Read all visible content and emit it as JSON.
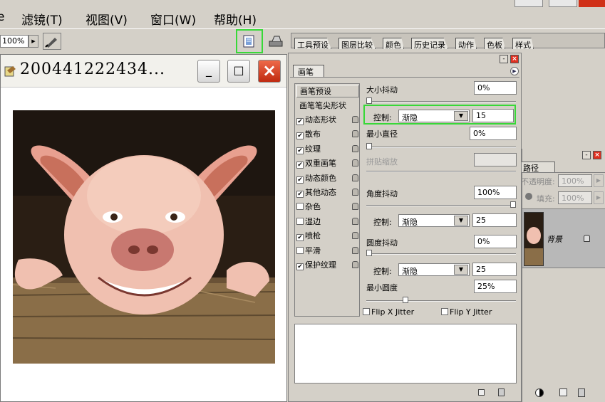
{
  "menu": [
    "滤镜(T)",
    "视图(V)",
    "窗口(W)",
    "帮助(H)"
  ],
  "toolbar": {
    "zoom": "100%"
  },
  "palette_well": {
    "tabs": [
      "工具预设",
      "图层比较",
      "颜色",
      "历史记录",
      "动作",
      "色板",
      "样式"
    ]
  },
  "document": {
    "title": "200441222434...",
    "minimize": "_",
    "maximize": "□",
    "close": "×"
  },
  "brush_panel": {
    "tab": "画笔",
    "preset_button": "画笔预设",
    "tip_header": "画笔笔尖形状",
    "options": [
      {
        "label": "动态形状",
        "checked": true
      },
      {
        "label": "散布",
        "checked": true
      },
      {
        "label": "纹理",
        "checked": true
      },
      {
        "label": "双重画笔",
        "checked": true
      },
      {
        "label": "动态颜色",
        "checked": true
      },
      {
        "label": "其他动态",
        "checked": true
      },
      {
        "label": "杂色",
        "checked": false
      },
      {
        "label": "湿边",
        "checked": false
      },
      {
        "label": "喷枪",
        "checked": true
      },
      {
        "label": "平滑",
        "checked": false
      },
      {
        "label": "保护纹理",
        "checked": true
      }
    ],
    "size_jitter_label": "大小抖动",
    "size_jitter_value": "0%",
    "size_jitter_level": 0,
    "control_label": "控制:",
    "size_control": "渐隐",
    "size_control_value": "15",
    "min_diameter_label": "最小直径",
    "min_diameter_value": "0%",
    "min_diameter_level": 0,
    "tilt_scale_label": "拼贴缩放",
    "tilt_scale_value": "",
    "angle_jitter_label": "角度抖动",
    "angle_jitter_value": "100%",
    "angle_jitter_level": 1,
    "angle_control": "渐隐",
    "angle_control_value": "25",
    "roundness_jitter_label": "圆度抖动",
    "roundness_jitter_value": "0%",
    "roundness_jitter_level": 0,
    "roundness_control": "渐隐",
    "roundness_control_value": "25",
    "min_roundness_label": "最小圆度",
    "min_roundness_value": "25%",
    "min_roundness_level": 0.25,
    "flip_x": "Flip X Jitter",
    "flip_y": "Flip Y Jitter"
  },
  "layers_panel": {
    "tab": "路径",
    "opacity_label": "不透明度:",
    "opacity_value": "100%",
    "fill_label": "填充:",
    "fill_value": "100%",
    "layer_name": "背景"
  },
  "colors": {
    "highlight": "#38d838",
    "close": "#e03020"
  }
}
